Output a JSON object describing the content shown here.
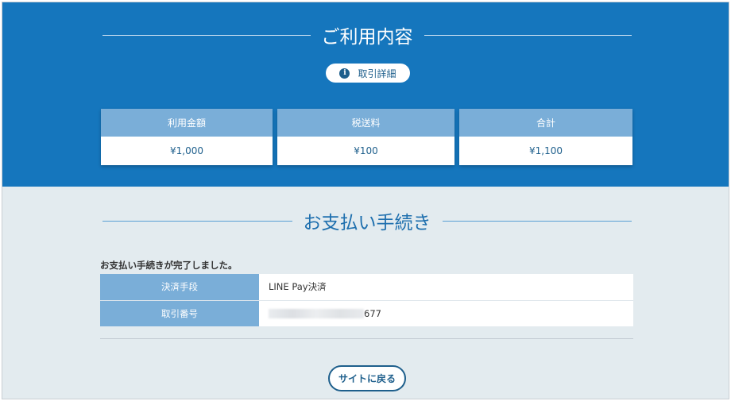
{
  "usage": {
    "title": "ご利用内容",
    "detail_button": "取引詳細",
    "detail_icon": "info-icon",
    "amounts": [
      {
        "label": "利用金額",
        "value": "¥1,000"
      },
      {
        "label": "税送料",
        "value": "¥100"
      },
      {
        "label": "合計",
        "value": "¥1,100"
      }
    ]
  },
  "payment": {
    "title": "お支払い手続き",
    "complete_message": "お支払い手続きが完了しました。",
    "rows": [
      {
        "label": "決済手段",
        "value": "LINE Pay決済"
      },
      {
        "label": "取引番号",
        "value_suffix": "677"
      }
    ],
    "back_button": "サイトに戻る"
  },
  "colors": {
    "header_blue": "#1576bd",
    "card_label_blue": "#7aaed8",
    "text_blue": "#1e5f8c",
    "section_bg": "#e3ebef"
  }
}
